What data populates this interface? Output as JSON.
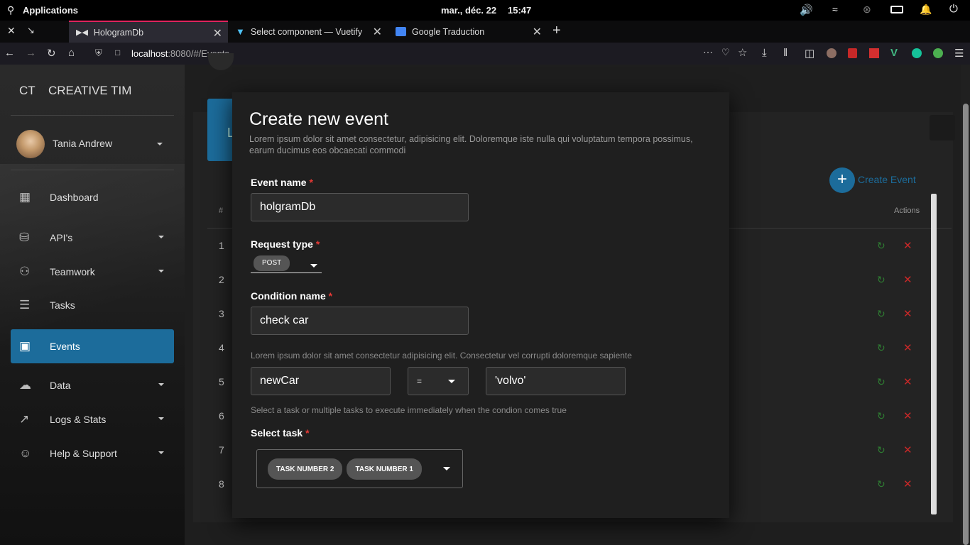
{
  "system_bar": {
    "applications": "Applications",
    "datetime": "mar., déc. 22",
    "time": "15:47"
  },
  "tabs": [
    {
      "title": "HologramDb",
      "active": true
    },
    {
      "title": "Select component — Vuetify",
      "active": false
    },
    {
      "title": "Google Traduction",
      "active": false
    }
  ],
  "url": {
    "host": "localhost",
    "rest": ":8080/#/Events"
  },
  "sidebar": {
    "logo_mini": "CT",
    "logo_text": "CREATIVE TIM",
    "user": "Tania Andrew",
    "items": [
      {
        "label": "Dashboard",
        "icon": "dashboard-icon",
        "caret": false,
        "active": false
      },
      {
        "label": "API's",
        "icon": "database-icon",
        "caret": true,
        "active": false
      },
      {
        "label": "Teamwork",
        "icon": "people-icon",
        "caret": true,
        "active": false
      },
      {
        "label": "Tasks",
        "icon": "checklist-icon",
        "caret": false,
        "active": false
      },
      {
        "label": "Events",
        "icon": "calendar-icon",
        "caret": false,
        "active": true
      },
      {
        "label": "Data",
        "icon": "cloud-upload-icon",
        "caret": true,
        "active": false
      },
      {
        "label": "Logs & Stats",
        "icon": "chart-line-icon",
        "caret": true,
        "active": false
      },
      {
        "label": "Help & Support",
        "icon": "support-icon",
        "caret": true,
        "active": false
      }
    ]
  },
  "table": {
    "hash_header": "#",
    "actions_header": "Actions",
    "create_label": "Create Event",
    "rows": [
      "1",
      "2",
      "3",
      "4",
      "5",
      "6",
      "7",
      "8"
    ]
  },
  "modal": {
    "title": "Create new event",
    "subtitle": "Lorem ipsum dolor sit amet consectetur, adipisicing elit. Doloremque iste nulla qui voluptatum tempora possimus, earum ducimus eos obcaecati commodi",
    "event_name_label": "Event name",
    "event_name_value": "holgramDb",
    "request_type_label": "Request type",
    "request_type_value": "POST",
    "condition_name_label": "Condition name",
    "condition_name_value": "check car",
    "condition_hint": "Lorem ipsum dolor sit amet consectetur adipisicing elit. Consectetur vel corrupti doloremque sapiente",
    "condition_left": "newCar",
    "condition_operator": "=",
    "condition_right": "'volvo'",
    "task_hint": "Select a task or multiple tasks to execute immediately when the condion comes true",
    "select_task_label": "Select task",
    "tasks": [
      "TASK NUMBER 2",
      "TASK NUMBER 1"
    ],
    "required_mark": "*"
  }
}
